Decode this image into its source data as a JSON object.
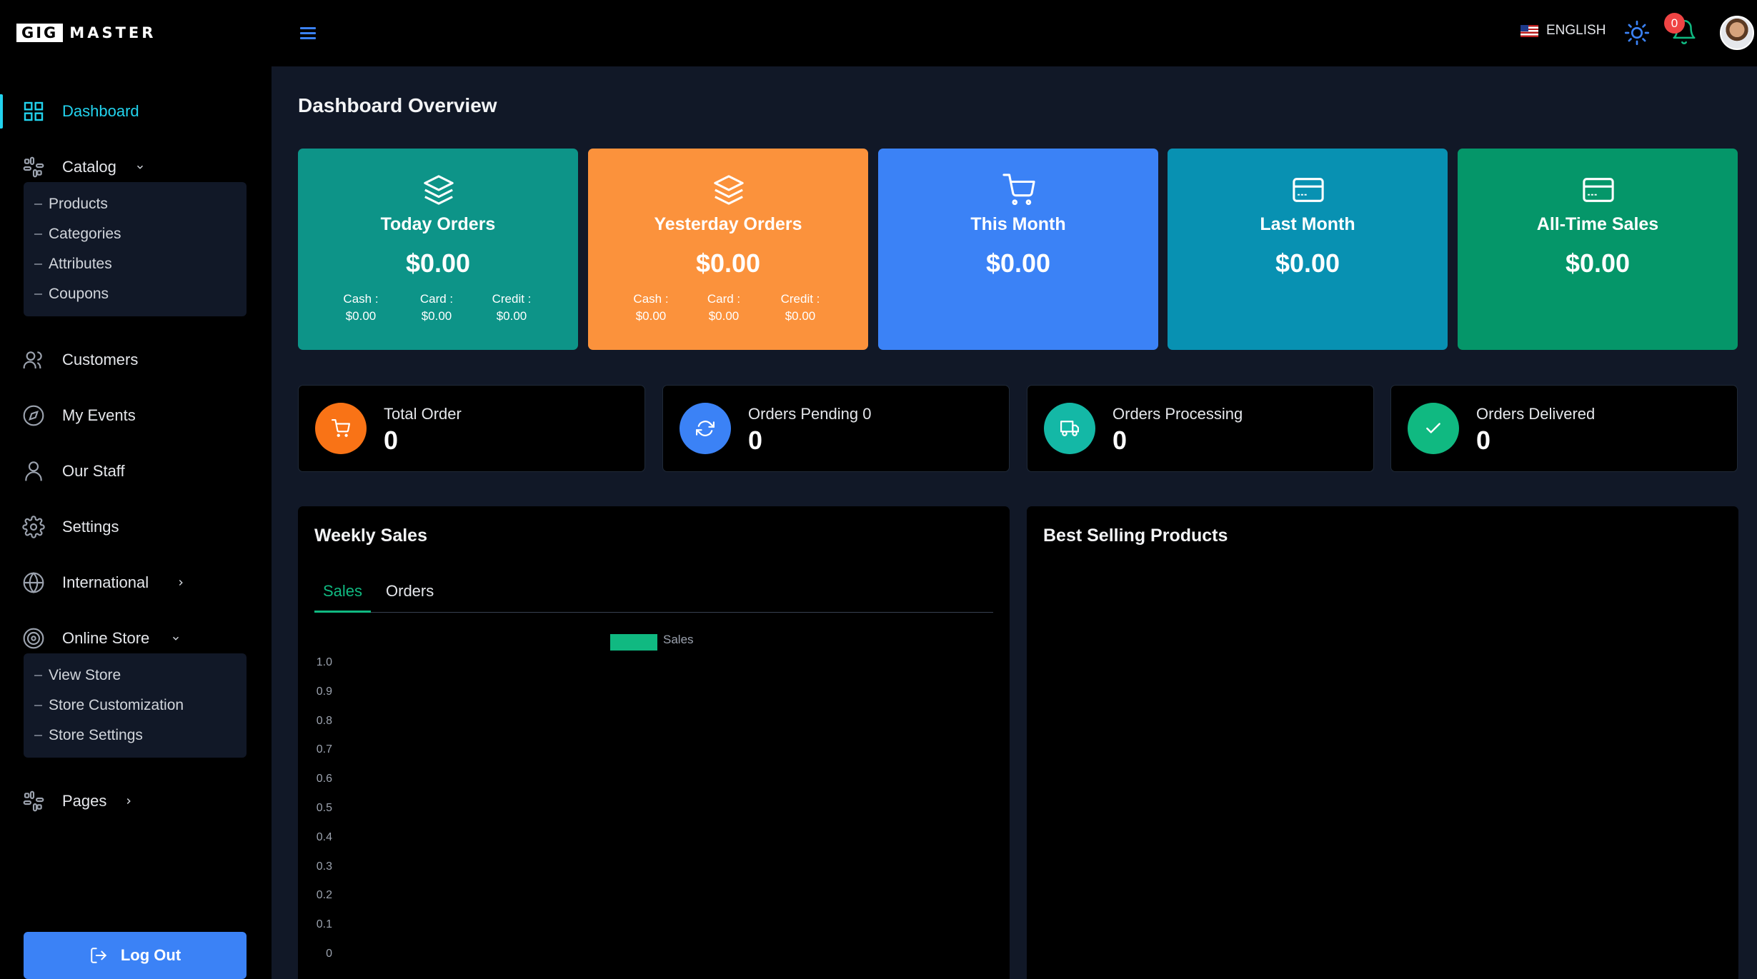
{
  "brand": {
    "left": "GIG",
    "right": "MASTER"
  },
  "topbar": {
    "language": "ENGLISH",
    "notification_count": "0"
  },
  "sidebar": {
    "dashboard": "Dashboard",
    "catalog": "Catalog",
    "catalog_items": [
      "Products",
      "Categories",
      "Attributes",
      "Coupons"
    ],
    "customers": "Customers",
    "my_events": "My Events",
    "our_staff": "Our Staff",
    "settings": "Settings",
    "international": "International",
    "online_store": "Online Store",
    "online_store_items": [
      "View Store",
      "Store Customization",
      "Store Settings"
    ],
    "pages": "Pages",
    "logout": "Log Out"
  },
  "page": {
    "title": "Dashboard Overview"
  },
  "stat_cards": [
    {
      "title": "Today Orders",
      "amount": "$0.00",
      "color": "#0d9488",
      "icon": "layers-icon",
      "breakdown": [
        {
          "label": "Cash :",
          "value": "$0.00"
        },
        {
          "label": "Card :",
          "value": "$0.00"
        },
        {
          "label": "Credit :",
          "value": "$0.00"
        }
      ]
    },
    {
      "title": "Yesterday Orders",
      "amount": "$0.00",
      "color": "#fb923c",
      "icon": "layers-icon",
      "breakdown": [
        {
          "label": "Cash :",
          "value": "$0.00"
        },
        {
          "label": "Card :",
          "value": "$0.00"
        },
        {
          "label": "Credit :",
          "value": "$0.00"
        }
      ]
    },
    {
      "title": "This Month",
      "amount": "$0.00",
      "color": "#3b82f6",
      "icon": "cart-icon"
    },
    {
      "title": "Last Month",
      "amount": "$0.00",
      "color": "#0891b2",
      "icon": "credit-card-icon"
    },
    {
      "title": "All-Time Sales",
      "amount": "$0.00",
      "color": "#059669",
      "icon": "credit-card-icon"
    }
  ],
  "order_cards": [
    {
      "label": "Total Order",
      "value": "0",
      "color": "#f97316",
      "icon": "cart-icon"
    },
    {
      "label": "Orders Pending 0",
      "value": "0",
      "color": "#3b82f6",
      "icon": "refresh-icon"
    },
    {
      "label": "Orders Processing",
      "value": "0",
      "color": "#14b8a6",
      "icon": "truck-icon"
    },
    {
      "label": "Orders Delivered",
      "value": "0",
      "color": "#10b981",
      "icon": "check-icon"
    }
  ],
  "weekly_sales": {
    "title": "Weekly Sales",
    "tabs": [
      "Sales",
      "Orders"
    ],
    "active_tab": "Sales"
  },
  "best_selling": {
    "title": "Best Selling Products"
  },
  "chart_data": {
    "type": "bar",
    "series": [
      {
        "name": "Sales",
        "values": []
      }
    ],
    "categories": [],
    "ylim": [
      0,
      1.0
    ],
    "yticks": [
      "1.0",
      "0.9",
      "0.8",
      "0.7",
      "0.6",
      "0.5",
      "0.4",
      "0.3",
      "0.2",
      "0.1",
      "0"
    ],
    "legend": "top-center",
    "colors": {
      "Sales": "#10b981"
    }
  }
}
